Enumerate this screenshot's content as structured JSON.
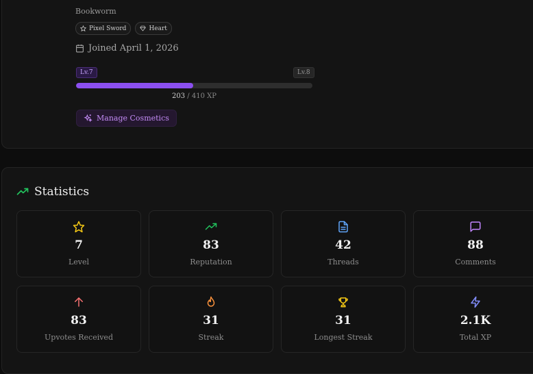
{
  "profile": {
    "username": "Bookworm",
    "badges": [
      {
        "label": "Pixel Sword",
        "icon": "star-icon"
      },
      {
        "label": "Heart",
        "icon": "diamond-icon"
      }
    ],
    "joined": "Joined April 1, 2026",
    "level_current": "Lv.7",
    "level_next": "Lv.8",
    "xp_current": "203",
    "xp_separator": "/",
    "xp_total": "410 XP",
    "xp_progress": 0.495,
    "xp_bar_color": "#8b4ff0",
    "manage_cosmetics_label": "Manage Cosmetics"
  },
  "statistics": {
    "title": "Statistics",
    "accent": "#22c55e",
    "items": [
      {
        "value": "7",
        "label": "Level",
        "icon": "star-icon",
        "color": "#facc15"
      },
      {
        "value": "83",
        "label": "Reputation",
        "icon": "trending-up-icon",
        "color": "#22c55e"
      },
      {
        "value": "42",
        "label": "Threads",
        "icon": "document-icon",
        "color": "#60a5fa"
      },
      {
        "value": "88",
        "label": "Comments",
        "icon": "message-square-icon",
        "color": "#c084fc"
      },
      {
        "value": "83",
        "label": "Upvotes Received",
        "icon": "arrow-up-icon",
        "color": "#f87171"
      },
      {
        "value": "31",
        "label": "Streak",
        "icon": "flame-icon",
        "color": "#fb923c"
      },
      {
        "value": "31",
        "label": "Longest Streak",
        "icon": "trophy-icon",
        "color": "#facc15"
      },
      {
        "value": "2.1K",
        "label": "Total XP",
        "icon": "zap-icon",
        "color": "#818cf8"
      }
    ]
  }
}
